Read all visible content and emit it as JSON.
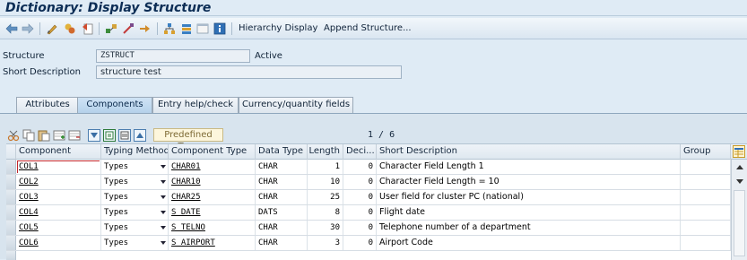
{
  "window": {
    "title": "Dictionary: Display Structure"
  },
  "toolbar": {
    "icons": [
      "back-arrow-icon",
      "forward-arrow-icon",
      "toggle-change-display-icon",
      "check-object-icon",
      "activate-icon",
      "where-used-list-icon",
      "other-object-icon",
      "display-object-list-icon",
      "navigation-window-icon",
      "information-icon"
    ],
    "hierarchy_display": "Hierarchy Display",
    "append_structure": "Append Structure..."
  },
  "header": {
    "structure_label": "Structure",
    "structure_value": "ZSTRUCT",
    "status": "Active",
    "short_desc_label": "Short Description",
    "short_desc_value": "structure test"
  },
  "tabs": [
    {
      "label": "Attributes",
      "active": false
    },
    {
      "label": "Components",
      "active": true
    },
    {
      "label": "Entry help/check",
      "active": false
    },
    {
      "label": "Currency/quantity fields",
      "active": false
    }
  ],
  "grid_toolbar": {
    "predefined_type": "Predefined Type",
    "pager": "1 / 6"
  },
  "columns": {
    "component": "Component",
    "typing_method": "Typing Method",
    "component_type": "Component Type",
    "data_type": "Data Type",
    "length": "Length",
    "decimals": "Deci...",
    "short_description": "Short Description",
    "group": "Group"
  },
  "rows": [
    {
      "component": "COL1",
      "typing": "Types",
      "ctype": "CHAR01",
      "dtype": "CHAR",
      "length": "1",
      "dec": "0",
      "desc": "Character Field Length 1"
    },
    {
      "component": "COL2",
      "typing": "Types",
      "ctype": "CHAR10",
      "dtype": "CHAR",
      "length": "10",
      "dec": "0",
      "desc": "Character Field Length = 10"
    },
    {
      "component": "COL3",
      "typing": "Types",
      "ctype": "CHAR25",
      "dtype": "CHAR",
      "length": "25",
      "dec": "0",
      "desc": "User field for cluster PC (national)"
    },
    {
      "component": "COL4",
      "typing": "Types",
      "ctype": "S_DATE",
      "dtype": "DATS",
      "length": "8",
      "dec": "0",
      "desc": "Flight date"
    },
    {
      "component": "COL5",
      "typing": "Types",
      "ctype": "S_TELNO",
      "dtype": "CHAR",
      "length": "30",
      "dec": "0",
      "desc": "Telephone number of a department"
    },
    {
      "component": "COL6",
      "typing": "Types",
      "ctype": "S_AIRPORT",
      "dtype": "CHAR",
      "length": "3",
      "dec": "0",
      "desc": "Airport Code"
    }
  ],
  "colors": {
    "background": "#dfebf5",
    "title": "#0c2d55",
    "active_tab": "#b5d1ea",
    "predefined_bg": "#fdf6dc"
  }
}
